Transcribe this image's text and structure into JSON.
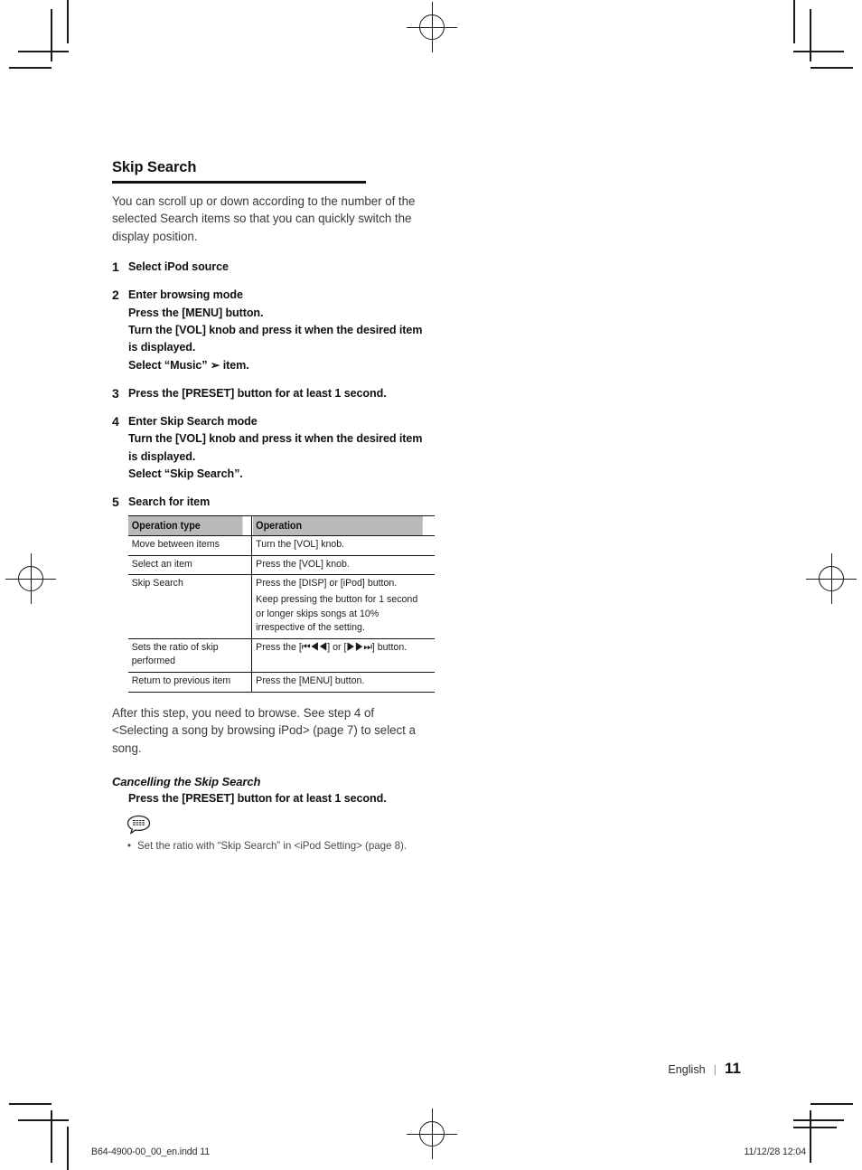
{
  "document": {
    "heading": "Skip Search",
    "intro": "You can scroll up or down according to the number of the selected Search items so that you can quickly switch the display position.",
    "steps": [
      {
        "number": "1",
        "lines": [
          "Select iPod source"
        ]
      },
      {
        "number": "2",
        "lines": [
          "Enter browsing mode",
          "Press the [MENU] button.",
          "Turn the [VOL] knob and press it when the desired item is displayed.",
          "Select “Music” ➢ item."
        ]
      },
      {
        "number": "3",
        "lines": [
          "Press the [PRESET] button for at least 1 second."
        ]
      },
      {
        "number": "4",
        "lines": [
          "Enter Skip Search mode",
          "Turn the [VOL] knob and press it when the desired item is displayed.",
          "Select “Skip Search”."
        ]
      },
      {
        "number": "5",
        "lines": [
          "Search for item"
        ]
      }
    ],
    "table": {
      "headers": [
        "Operation type",
        "Operation"
      ],
      "rows": [
        {
          "type": "Move between items",
          "operation": [
            "Turn the [VOL] knob."
          ]
        },
        {
          "type": "Select an item",
          "operation": [
            "Press the [VOL] knob."
          ]
        },
        {
          "type": "Skip Search",
          "operation": [
            "Press the [DISP] or [iPod] button.",
            "Keep pressing the button for 1 second or longer skips songs at 10% irrespective of the setting."
          ]
        },
        {
          "type": "Sets the ratio of skip performed",
          "operation": [
            "Press the [⏮◀◀] or [▶▶⏭] button."
          ]
        },
        {
          "type": "Return to previous item",
          "operation": [
            "Press the [MENU] button."
          ]
        }
      ]
    },
    "after_table_note": "After this step, you need to browse. See step 4 of <Selecting a song by browsing iPod> (page 7) to select a song.",
    "subsection": {
      "title": "Cancelling the Skip Search",
      "body": "Press the [PRESET] button for at least 1 second."
    },
    "note": {
      "icon": "note-bubble-icon",
      "bullet": "•",
      "items": [
        "Set the ratio with “Skip Search” in <iPod Setting> (page 8)."
      ]
    }
  },
  "footer": {
    "language": "English",
    "separator": "|",
    "page_number": "11"
  },
  "imprint": {
    "left": "B64-4900-00_00_en.indd   11",
    "right": "11/12/28   12:04"
  },
  "colors": {
    "text": "#1a1a1a",
    "body_text": "#3a3a3a",
    "table_header_bg": "#b9b9b9",
    "rule": "#111111"
  }
}
